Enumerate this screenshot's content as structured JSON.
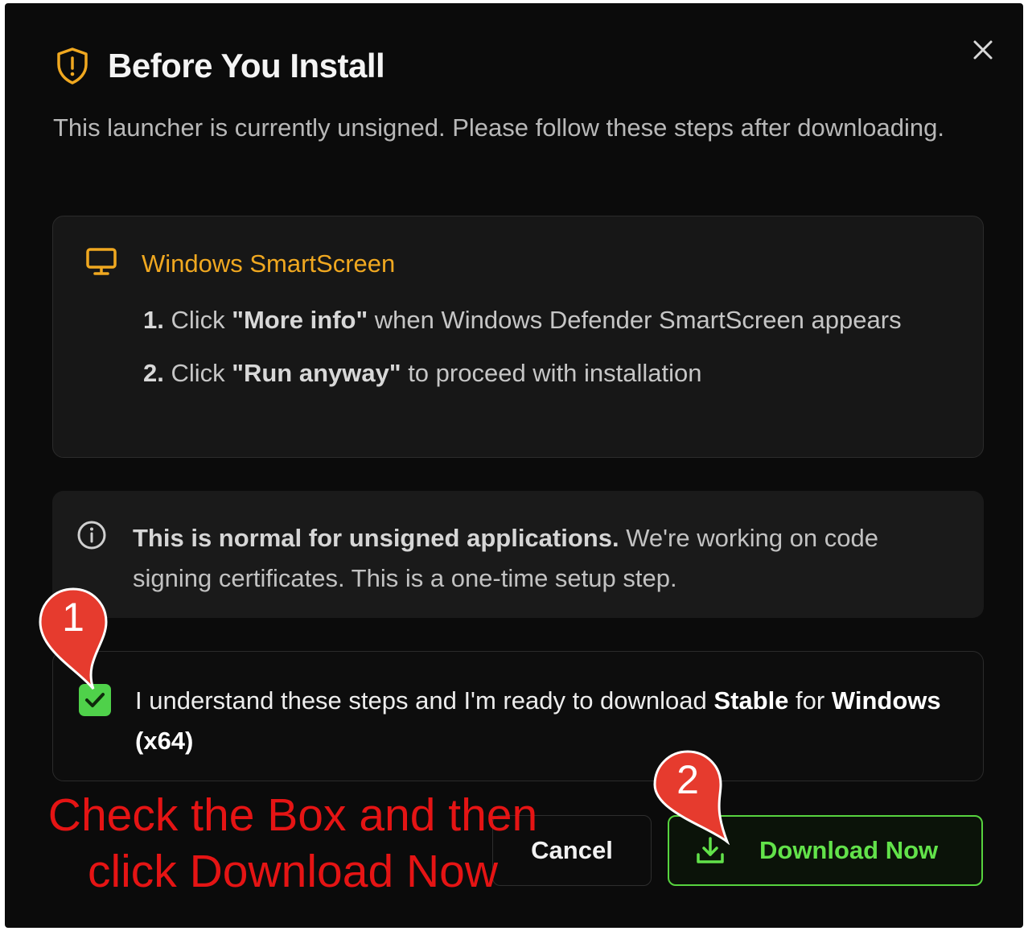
{
  "dialog": {
    "title": "Before You Install",
    "subtitle": "This launcher is currently unsigned. Please follow these steps after downloading.",
    "close_icon": "close-icon",
    "title_icon": "shield-alert-icon"
  },
  "smartscreen": {
    "icon": "monitor-icon",
    "title": "Windows SmartScreen",
    "steps": [
      {
        "number": "1.",
        "pre": "Click",
        "bold": "\"More info\"",
        "post": "when Windows Defender SmartScreen appears"
      },
      {
        "number": "2.",
        "pre": "Click",
        "bold": "\"Run anyway\"",
        "post": "to proceed with installation"
      }
    ]
  },
  "notice": {
    "icon": "info-icon",
    "bold": "This is normal for unsigned applications.",
    "text": "We're working on code signing certificates. This is a one-time setup step."
  },
  "consent": {
    "checked": true,
    "text_before": "I understand these steps and I'm ready to download",
    "channel": "Stable",
    "text_middle": "for",
    "platform": "Windows (x64)"
  },
  "actions": {
    "cancel_label": "Cancel",
    "download_label": "Download Now",
    "download_icon": "download-icon"
  },
  "overlay": {
    "instruction_line1": "Check the Box and then",
    "instruction_line2": "click Download Now",
    "marker1": "1",
    "marker2": "2"
  },
  "colors": {
    "background": "#0b0b0b",
    "accent_orange": "#f0a820",
    "accent_green": "#57d33f",
    "annotation_red": "#e51414"
  }
}
